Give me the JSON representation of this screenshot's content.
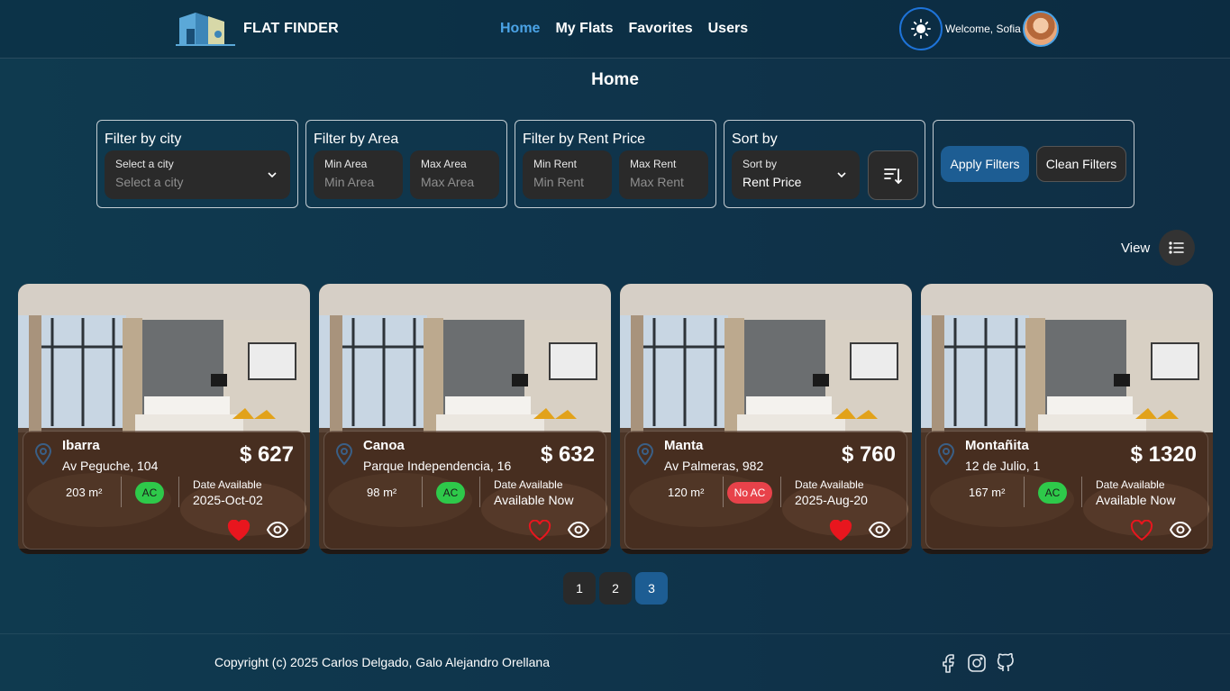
{
  "navbar": {
    "brand": "FLAT FINDER",
    "links": [
      "Home",
      "My Flats",
      "Favorites",
      "Users"
    ],
    "active_link": "Home",
    "welcome": "Welcome, Sofia",
    "theme_icon": "sun-icon",
    "accent_color": "#4ba3e6"
  },
  "page": {
    "title": "Home"
  },
  "filters": {
    "city": {
      "title": "Filter by city",
      "label": "Select a city",
      "placeholder": "Select a city"
    },
    "area": {
      "title": "Filter by Area",
      "min_label": "Min Area",
      "min_placeholder": "Min Area",
      "max_label": "Max Area",
      "max_placeholder": "Max Area"
    },
    "rent": {
      "title": "Filter by Rent Price",
      "min_label": "Min Rent",
      "min_placeholder": "Min Rent",
      "max_label": "Max Rent",
      "max_placeholder": "Max Rent"
    },
    "sort": {
      "title": "Sort by",
      "label": "Sort by",
      "value": "Rent Price"
    },
    "apply_label": "Apply Filters",
    "clean_label": "Clean Filters"
  },
  "view": {
    "label": "View",
    "icon": "list-view-icon"
  },
  "flats": [
    {
      "city": "Ibarra",
      "street": "Av Peguche, 104",
      "price": "$ 627",
      "area": "203 m²",
      "ac": "AC",
      "has_ac": true,
      "date_label": "Date Available",
      "date": "2025-Oct-02",
      "favorite": true
    },
    {
      "city": "Canoa",
      "street": "Parque Independencia, 16",
      "price": "$ 632",
      "area": "98 m²",
      "ac": "AC",
      "has_ac": true,
      "date_label": "Date Available",
      "date": "Available Now",
      "favorite": false
    },
    {
      "city": "Manta",
      "street": "Av Palmeras, 982",
      "price": "$ 760",
      "area": "120 m²",
      "ac": "No AC",
      "has_ac": false,
      "date_label": "Date Available",
      "date": "2025-Aug-20",
      "favorite": true
    },
    {
      "city": "Montañita",
      "street": "12 de Julio, 1",
      "price": "$ 1320",
      "area": "167 m²",
      "ac": "AC",
      "has_ac": true,
      "date_label": "Date Available",
      "date": "Available Now",
      "favorite": false
    }
  ],
  "pagination": {
    "pages": [
      "1",
      "2",
      "3"
    ],
    "current": "3"
  },
  "footer": {
    "copyright": "Copyright (c) 2025 Carlos Delgado, Galo Alejandro Orellana",
    "social_icons": [
      "facebook-icon",
      "instagram-icon",
      "github-icon"
    ]
  },
  "colors": {
    "primary_button": "#1d5d93",
    "ac_badge": "#2ec94a",
    "no_ac_badge": "#e8424a",
    "favorite_heart": "#e8161e"
  }
}
